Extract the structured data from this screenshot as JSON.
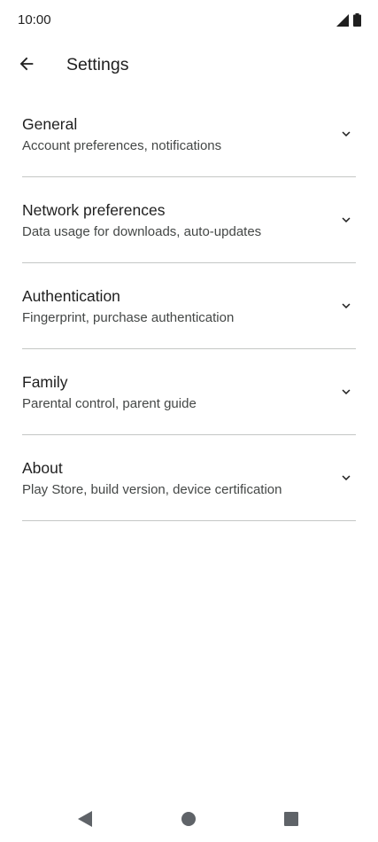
{
  "status_bar": {
    "time": "10:00",
    "icons": [
      "signal-icon",
      "battery-icon"
    ]
  },
  "app_bar": {
    "back_icon": "arrow-back-icon",
    "title": "Settings"
  },
  "settings": {
    "items": [
      {
        "title": "General",
        "subtitle": "Account preferences, notifications",
        "icon": "chevron-down-icon"
      },
      {
        "title": "Network preferences",
        "subtitle": "Data usage for downloads, auto-updates",
        "icon": "chevron-down-icon"
      },
      {
        "title": "Authentication",
        "subtitle": "Fingerprint, purchase authentication",
        "icon": "chevron-down-icon"
      },
      {
        "title": "Family",
        "subtitle": "Parental control, parent guide",
        "icon": "chevron-down-icon"
      },
      {
        "title": "About",
        "subtitle": "Play Store, build version, device certification",
        "icon": "chevron-down-icon"
      }
    ]
  },
  "nav_bar": {
    "buttons": [
      "nav-back-icon",
      "nav-home-icon",
      "nav-recents-icon"
    ]
  },
  "colors": {
    "background": "#ffffff",
    "text_primary": "#1f1f1f",
    "text_secondary": "#444746",
    "divider": "#c4c7c5",
    "nav_icon": "#5f6368"
  }
}
